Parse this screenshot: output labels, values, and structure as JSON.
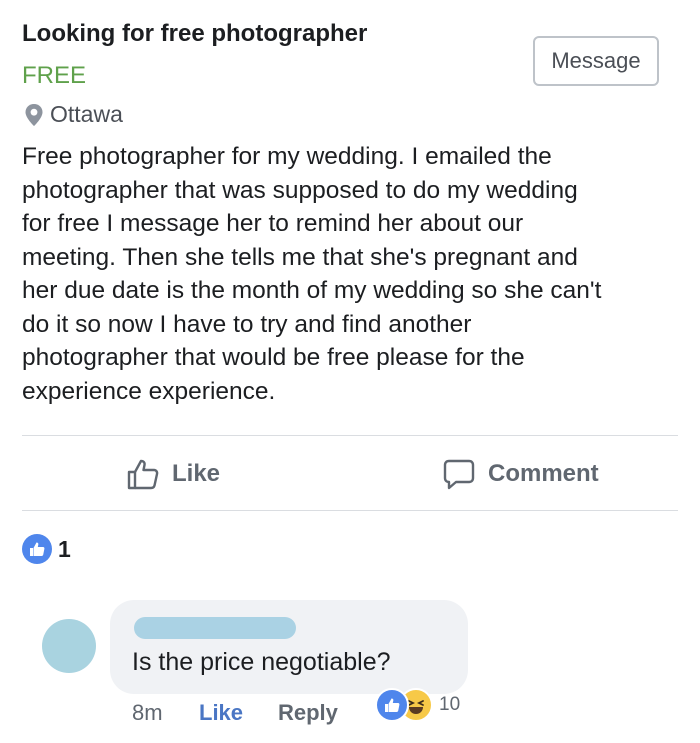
{
  "listing": {
    "title": "Looking for free photographer",
    "price": "FREE",
    "location": "Ottawa",
    "location_icon": "map-pin-icon",
    "message_button": "Message",
    "description": "Free photographer for my wedding. I emailed the\nphotographer that was supposed to do my wedding\nfor free I message her to remind her about our\nmeeting. Then she tells me that she's pregnant and\nher due date is the month of my wedding so she can't\ndo it so now I have to try and find another\nphotographer that would be free please for the\nexperience experience."
  },
  "actions": {
    "like_label": "Like",
    "like_icon": "thumbs-up-outline-icon",
    "comment_label": "Comment",
    "comment_icon": "speech-bubble-icon"
  },
  "reactions": {
    "icon": "like-reaction-icon",
    "count": "1"
  },
  "comment": {
    "text": "Is the price negotiable?",
    "time": "8m",
    "like_label": "Like",
    "reply_label": "Reply",
    "reaction_icons": [
      "like-reaction-icon",
      "haha-reaction-icon"
    ],
    "reaction_count": "10"
  },
  "colors": {
    "price": "#5fa14b",
    "link_blue": "#4a76c4",
    "reaction_blue": "#4f86ec",
    "avatar": "#a9d3e0"
  }
}
